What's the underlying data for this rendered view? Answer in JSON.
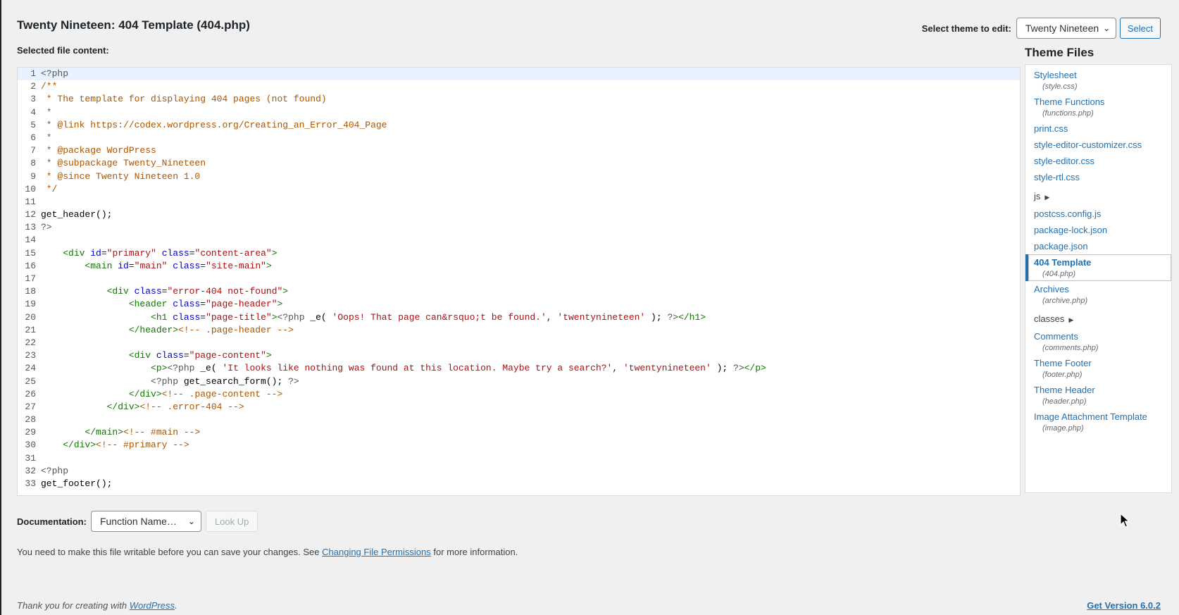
{
  "page": {
    "title": "Twenty Nineteen: 404 Template (404.php)",
    "selected_label": "Selected file content:"
  },
  "theme_select": {
    "label": "Select theme to edit:",
    "value": "Twenty Nineteen",
    "button": "Select"
  },
  "editor": {
    "lines": [
      [
        {
          "t": "<?php",
          "c": "k-php"
        }
      ],
      [
        {
          "t": "/**",
          "c": "k-com"
        }
      ],
      [
        {
          "t": " * The template for displaying 404 pages (not found)",
          "c": "k-com"
        }
      ],
      [
        {
          "t": " *",
          "c": "k-com"
        }
      ],
      [
        {
          "t": " * @link https://codex.wordpress.org/Creating_an_Error_404_Page",
          "c": "k-com"
        }
      ],
      [
        {
          "t": " *",
          "c": "k-com"
        }
      ],
      [
        {
          "t": " * @package WordPress",
          "c": "k-com"
        }
      ],
      [
        {
          "t": " * @subpackage Twenty_Nineteen",
          "c": "k-com"
        }
      ],
      [
        {
          "t": " * @since Twenty Nineteen 1.0",
          "c": "k-com"
        }
      ],
      [
        {
          "t": " */",
          "c": "k-com"
        }
      ],
      [],
      [
        {
          "t": "get_header();",
          "c": "k-fn"
        }
      ],
      [
        {
          "t": "?>",
          "c": "k-php"
        }
      ],
      [],
      [
        {
          "t": "    ",
          "c": ""
        },
        {
          "t": "<div ",
          "c": "k-tag"
        },
        {
          "t": "id",
          "c": "k-attr"
        },
        {
          "t": "=",
          "c": ""
        },
        {
          "t": "\"primary\"",
          "c": "k-str"
        },
        {
          "t": " ",
          "c": ""
        },
        {
          "t": "class",
          "c": "k-attr"
        },
        {
          "t": "=",
          "c": ""
        },
        {
          "t": "\"content-area\"",
          "c": "k-str"
        },
        {
          "t": ">",
          "c": "k-tag"
        }
      ],
      [
        {
          "t": "        ",
          "c": ""
        },
        {
          "t": "<main ",
          "c": "k-tag"
        },
        {
          "t": "id",
          "c": "k-attr"
        },
        {
          "t": "=",
          "c": ""
        },
        {
          "t": "\"main\"",
          "c": "k-str"
        },
        {
          "t": " ",
          "c": ""
        },
        {
          "t": "class",
          "c": "k-attr"
        },
        {
          "t": "=",
          "c": ""
        },
        {
          "t": "\"site-main\"",
          "c": "k-str"
        },
        {
          "t": ">",
          "c": "k-tag"
        }
      ],
      [],
      [
        {
          "t": "            ",
          "c": ""
        },
        {
          "t": "<div ",
          "c": "k-tag"
        },
        {
          "t": "class",
          "c": "k-attr"
        },
        {
          "t": "=",
          "c": ""
        },
        {
          "t": "\"error-404 not-found\"",
          "c": "k-str"
        },
        {
          "t": ">",
          "c": "k-tag"
        }
      ],
      [
        {
          "t": "                ",
          "c": ""
        },
        {
          "t": "<header ",
          "c": "k-tag"
        },
        {
          "t": "class",
          "c": "k-attr"
        },
        {
          "t": "=",
          "c": ""
        },
        {
          "t": "\"page-header\"",
          "c": "k-str"
        },
        {
          "t": ">",
          "c": "k-tag"
        }
      ],
      [
        {
          "t": "                    ",
          "c": ""
        },
        {
          "t": "<h1 ",
          "c": "k-tag"
        },
        {
          "t": "class",
          "c": "k-attr"
        },
        {
          "t": "=",
          "c": ""
        },
        {
          "t": "\"page-title\"",
          "c": "k-str"
        },
        {
          "t": ">",
          "c": "k-tag"
        },
        {
          "t": "<?php ",
          "c": "k-php"
        },
        {
          "t": "_e( ",
          "c": "k-fn"
        },
        {
          "t": "'Oops! That page can&rsquo;t be found.'",
          "c": "k-str"
        },
        {
          "t": ", ",
          "c": ""
        },
        {
          "t": "'twentynineteen'",
          "c": "k-str"
        },
        {
          "t": " ); ",
          "c": "k-fn"
        },
        {
          "t": "?>",
          "c": "k-php"
        },
        {
          "t": "</h1>",
          "c": "k-tag"
        }
      ],
      [
        {
          "t": "                ",
          "c": ""
        },
        {
          "t": "</header>",
          "c": "k-tag"
        },
        {
          "t": "<!-- .page-header -->",
          "c": "k-com"
        }
      ],
      [],
      [
        {
          "t": "                ",
          "c": ""
        },
        {
          "t": "<div ",
          "c": "k-tag"
        },
        {
          "t": "class",
          "c": "k-attr"
        },
        {
          "t": "=",
          "c": ""
        },
        {
          "t": "\"page-content\"",
          "c": "k-str"
        },
        {
          "t": ">",
          "c": "k-tag"
        }
      ],
      [
        {
          "t": "                    ",
          "c": ""
        },
        {
          "t": "<p>",
          "c": "k-tag"
        },
        {
          "t": "<?php ",
          "c": "k-php"
        },
        {
          "t": "_e( ",
          "c": "k-fn"
        },
        {
          "t": "'It looks like nothing was found at this location. Maybe try a search?'",
          "c": "k-str"
        },
        {
          "t": ", ",
          "c": ""
        },
        {
          "t": "'twentynineteen'",
          "c": "k-str"
        },
        {
          "t": " ); ",
          "c": "k-fn"
        },
        {
          "t": "?>",
          "c": "k-php"
        },
        {
          "t": "</p>",
          "c": "k-tag"
        }
      ],
      [
        {
          "t": "                    ",
          "c": ""
        },
        {
          "t": "<?php ",
          "c": "k-php"
        },
        {
          "t": "get_search_form(); ",
          "c": "k-fn"
        },
        {
          "t": "?>",
          "c": "k-php"
        }
      ],
      [
        {
          "t": "                ",
          "c": ""
        },
        {
          "t": "</div>",
          "c": "k-tag"
        },
        {
          "t": "<!-- .page-content -->",
          "c": "k-com"
        }
      ],
      [
        {
          "t": "            ",
          "c": ""
        },
        {
          "t": "</div>",
          "c": "k-tag"
        },
        {
          "t": "<!-- .error-404 -->",
          "c": "k-com"
        }
      ],
      [],
      [
        {
          "t": "        ",
          "c": ""
        },
        {
          "t": "</main>",
          "c": "k-tag"
        },
        {
          "t": "<!-- #main -->",
          "c": "k-com"
        }
      ],
      [
        {
          "t": "    ",
          "c": ""
        },
        {
          "t": "</div>",
          "c": "k-tag"
        },
        {
          "t": "<!-- #primary -->",
          "c": "k-com"
        }
      ],
      [],
      [
        {
          "t": "<?php",
          "c": "k-php"
        }
      ],
      [
        {
          "t": "get_footer();",
          "c": "k-fn"
        }
      ]
    ]
  },
  "files": {
    "heading": "Theme Files",
    "items": [
      {
        "label": "Stylesheet",
        "file": "(style.css)"
      },
      {
        "label": "Theme Functions",
        "file": "(functions.php)"
      },
      {
        "label": "print.css",
        "file": ""
      },
      {
        "label": "style-editor-customizer.css",
        "file": ""
      },
      {
        "label": "style-editor.css",
        "file": ""
      },
      {
        "label": "style-rtl.css",
        "file": ""
      },
      {
        "label": "js",
        "file": "",
        "folder": true
      },
      {
        "label": "postcss.config.js",
        "file": ""
      },
      {
        "label": "package-lock.json",
        "file": ""
      },
      {
        "label": "package.json",
        "file": ""
      },
      {
        "label": "404 Template",
        "file": "(404.php)",
        "active": true
      },
      {
        "label": "Archives",
        "file": "(archive.php)"
      },
      {
        "label": "classes",
        "file": "",
        "folder": true
      },
      {
        "label": "Comments",
        "file": "(comments.php)"
      },
      {
        "label": "Theme Footer",
        "file": "(footer.php)"
      },
      {
        "label": "Theme Header",
        "file": "(header.php)"
      },
      {
        "label": "Image Attachment Template",
        "file": "(image.php)"
      }
    ]
  },
  "docs": {
    "label": "Documentation:",
    "select_value": "Function Name…",
    "lookup": "Look Up"
  },
  "notice": {
    "pre": "You need to make this file writable before you can save your changes. See ",
    "link": "Changing File Permissions",
    "post": " for more information."
  },
  "footer": {
    "thanks_pre": "Thank you for creating with ",
    "thanks_link": "WordPress",
    "thanks_post": ".",
    "version": "Get Version 6.0.2"
  },
  "icons": {
    "dropdown": "chevron-down-icon",
    "folder_expand": "triangle-right-icon",
    "cursor": "mouse-pointer-icon"
  }
}
